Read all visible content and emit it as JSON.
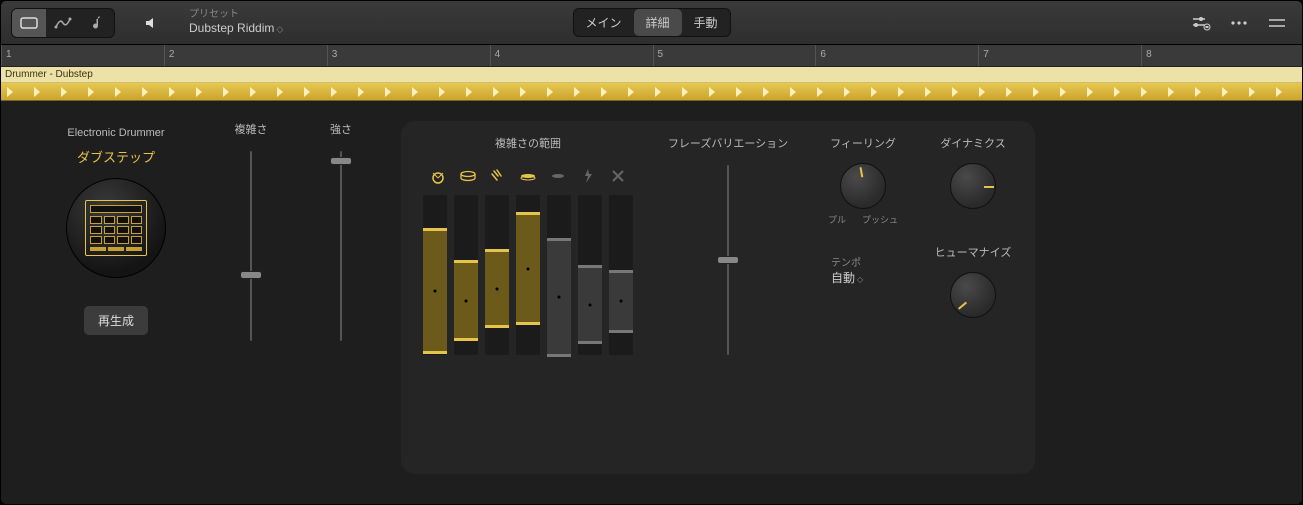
{
  "header": {
    "preset_label": "プリセット",
    "preset_name": "Dubstep Riddim",
    "tabs": [
      "メイン",
      "詳細",
      "手動"
    ],
    "active_tab": 1
  },
  "timeline": {
    "bars": [
      "1",
      "2",
      "3",
      "4",
      "5",
      "6",
      "7",
      "8"
    ],
    "region_name": "Drummer - Dubstep"
  },
  "editor": {
    "drummer_title": "Electronic Drummer",
    "drummer_style": "ダブステップ",
    "regenerate": "再生成",
    "complexity_label": "複雑さ",
    "loudness_label": "強さ",
    "complexity_value": 0.35,
    "loudness_value": 0.95,
    "range_label": "複雑さの範囲",
    "range_icons": [
      "kick-icon",
      "snare-icon",
      "clap-icon",
      "hihat-icon",
      "perc-icon",
      "fx-icon",
      "x-icon"
    ],
    "range_bars": [
      {
        "top": 0.78,
        "bottom": 0.02,
        "active": true
      },
      {
        "top": 0.58,
        "bottom": 0.1,
        "active": true
      },
      {
        "top": 0.65,
        "bottom": 0.18,
        "active": true
      },
      {
        "top": 0.88,
        "bottom": 0.2,
        "active": true
      },
      {
        "top": 0.72,
        "bottom": 0.0,
        "active": false
      },
      {
        "top": 0.55,
        "bottom": 0.08,
        "active": false
      },
      {
        "top": 0.52,
        "bottom": 0.15,
        "active": false
      }
    ],
    "phrase_label": "フレーズバリエーション",
    "phrase_value": 0.5,
    "feel_label": "フィーリング",
    "feel_sub_left": "プル",
    "feel_sub_right": "プッシュ",
    "dynamics_label": "ダイナミクス",
    "humanize_label": "ヒューマナイズ",
    "tempo_label": "テンポ",
    "tempo_value": "自動",
    "knob_feel_angle": -10,
    "knob_dyn_angle": 90,
    "knob_hum_angle": -130
  }
}
